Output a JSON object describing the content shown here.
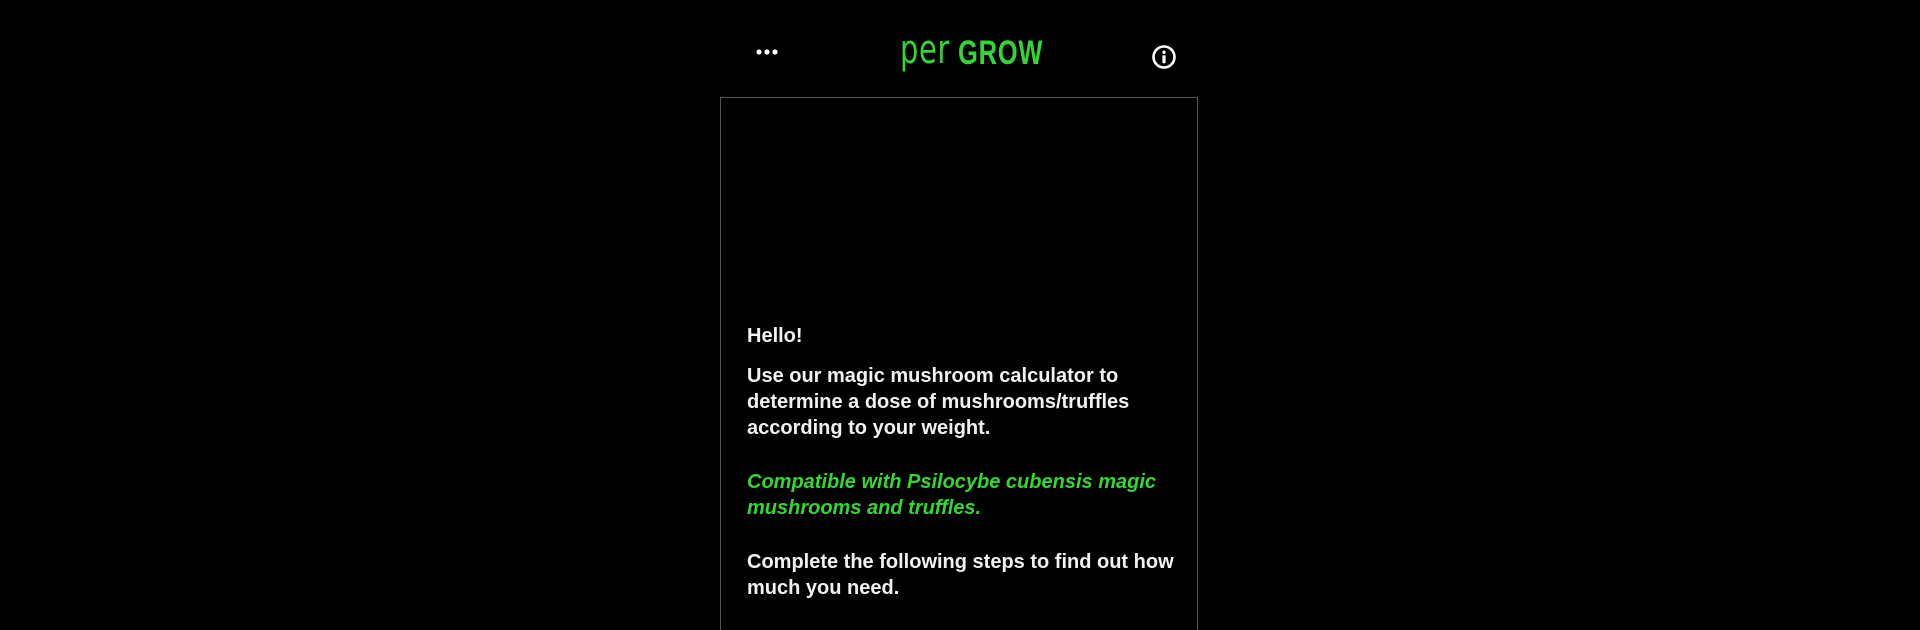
{
  "header": {
    "menu_icon": "ellipsis-icon",
    "logo_prefix": "per",
    "logo_suffix": "GROW",
    "info_icon": "info-icon"
  },
  "intro": {
    "greeting": "Hello!",
    "description": "Use our magic mushroom calculator to determine a dose of mushrooms/truffles according to your weight.",
    "compatibility": "Compatible with Psilocybe cubensis magic mushrooms and truffles.",
    "instructions": "Complete the following steps to find out how much you need."
  },
  "colors": {
    "background": "#000000",
    "accent": "#33d633",
    "text": "#f2f2f2",
    "border": "#555555"
  }
}
